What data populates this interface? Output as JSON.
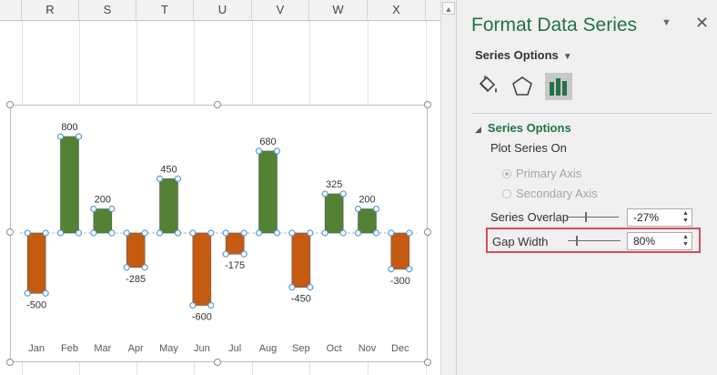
{
  "sheet": {
    "columns": [
      "R",
      "S",
      "T",
      "U",
      "V",
      "W",
      "X"
    ]
  },
  "chart_data": {
    "type": "bar",
    "categories": [
      "Jan",
      "Feb",
      "Mar",
      "Apr",
      "May",
      "Jun",
      "Jul",
      "Aug",
      "Sep",
      "Oct",
      "Nov",
      "Dec"
    ],
    "values": [
      -500,
      800,
      200,
      -285,
      450,
      -600,
      -175,
      680,
      -450,
      325,
      200,
      -300
    ],
    "data_labels": [
      "-500",
      "800",
      "200",
      "-285",
      "450",
      "-600",
      "-175",
      "680",
      "-450",
      "325",
      "200",
      "-300"
    ],
    "ylim": [
      -700,
      900
    ],
    "colors": {
      "positive": "#548235",
      "negative": "#c55a11",
      "handle": "#5b9bd5"
    },
    "title": "",
    "xlabel": "",
    "ylabel": "",
    "legend": "none"
  },
  "pane": {
    "title": "Format Data Series",
    "dropdown_icon": "triangle-down",
    "close_icon": "close-x",
    "menu_label": "Series Options",
    "tabs": [
      {
        "name": "fill-line",
        "icon": "paint-bucket-icon",
        "active": false
      },
      {
        "name": "effects",
        "icon": "pentagon-icon",
        "active": false
      },
      {
        "name": "series-options",
        "icon": "bar-chart-icon",
        "active": true
      }
    ],
    "section": {
      "title": "Series Options",
      "plot_series_on": "Plot Series On",
      "primary_axis": "Primary Axis",
      "secondary_axis": "Secondary Axis",
      "primary_checked": true,
      "series_overlap_label": "Series Overlap",
      "series_overlap_value": "-27%",
      "series_overlap_fraction": 0.365,
      "gap_width_label": "Gap Width",
      "gap_width_value": "80%",
      "gap_width_fraction": 0.16
    },
    "accent_color": "#217346",
    "highlight_color": "#d0505a"
  }
}
